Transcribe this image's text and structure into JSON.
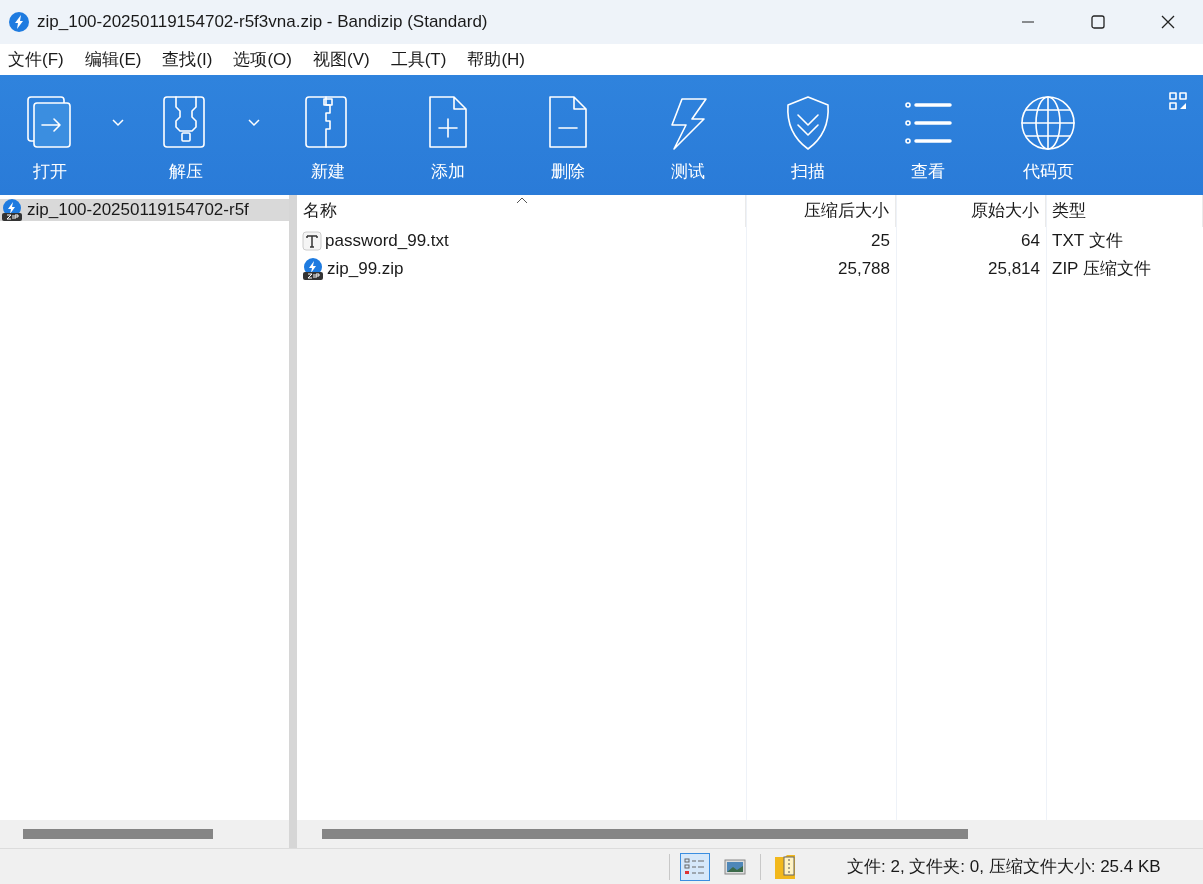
{
  "window": {
    "title": "zip_100-20250119154702-r5f3vna.zip - Bandizip (Standard)"
  },
  "menu": [
    "文件(F)",
    "编辑(E)",
    "查找(I)",
    "选项(O)",
    "视图(V)",
    "工具(T)",
    "帮助(H)"
  ],
  "toolbar": [
    {
      "label": "打开",
      "kind": "open",
      "dropdown": true
    },
    {
      "label": "解压",
      "kind": "extract",
      "dropdown": true
    },
    {
      "label": "新建",
      "kind": "new",
      "dropdown": false
    },
    {
      "label": "添加",
      "kind": "add",
      "dropdown": false
    },
    {
      "label": "删除",
      "kind": "delete",
      "dropdown": false
    },
    {
      "label": "测试",
      "kind": "test",
      "dropdown": false
    },
    {
      "label": "扫描",
      "kind": "scan",
      "dropdown": false
    },
    {
      "label": "查看",
      "kind": "view",
      "dropdown": false
    },
    {
      "label": "代码页",
      "kind": "codepage",
      "dropdown": false
    }
  ],
  "tree": [
    {
      "label": "zip_100-20250119154702-r5f",
      "selected": true
    }
  ],
  "table": {
    "columns": [
      {
        "label": "名称",
        "sorted": true
      },
      {
        "label": "压缩后大小",
        "sorted": false
      },
      {
        "label": "原始大小",
        "sorted": false
      },
      {
        "label": "类型",
        "sorted": false
      }
    ],
    "rows": [
      {
        "kind": "txt",
        "cells": [
          "password_99.txt",
          "25",
          "64",
          "TXT 文件"
        ]
      },
      {
        "kind": "zip",
        "cells": [
          "zip_99.zip",
          "25,788",
          "25,814",
          "ZIP 压缩文件"
        ]
      }
    ]
  },
  "status_bar": {
    "view_modes": [
      {
        "kind": "details",
        "selected": true
      },
      {
        "kind": "preview",
        "selected": false
      }
    ],
    "text": "文件: 2, 文件夹: 0, 压缩文件大小: 25.4 KB"
  }
}
